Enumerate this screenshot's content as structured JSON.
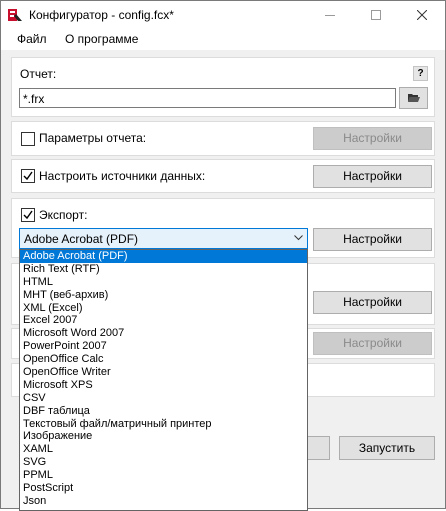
{
  "window": {
    "title": "Конфигуратор - config.fcx*"
  },
  "menu": {
    "file": "Файл",
    "about": "О программе"
  },
  "report": {
    "label": "Отчет:",
    "help": "?",
    "path": "*.frx"
  },
  "report_params": {
    "label": "Параметры отчета:",
    "checked": false,
    "button": "Настройки"
  },
  "data_sources": {
    "label": "Настроить источники данных:",
    "checked": true,
    "button": "Настройки"
  },
  "export": {
    "label": "Экспорт:",
    "checked": true,
    "selected": "Adobe Acrobat (PDF)",
    "button": "Настройки",
    "options": [
      "Adobe Acrobat (PDF)",
      "Rich Text (RTF)",
      "HTML",
      "MHT (веб-архив)",
      "XML (Excel)",
      "Excel 2007",
      "Microsoft Word 2007",
      "PowerPoint 2007",
      "OpenOffice Calc",
      "OpenOffice Writer",
      "Microsoft XPS",
      "CSV",
      "DBF таблица",
      "Текстовый файл/матричный принтер",
      "Изображение",
      "XAML",
      "SVG",
      "PPML",
      "PostScript",
      "Json"
    ]
  },
  "hidden_panels": {
    "button_a": "Настройки",
    "button_b": "Настройки"
  },
  "footer": {
    "run_button": "Запустить"
  },
  "colors": {
    "accent": "#0078d7",
    "window_bg": "#f0f0f0"
  }
}
